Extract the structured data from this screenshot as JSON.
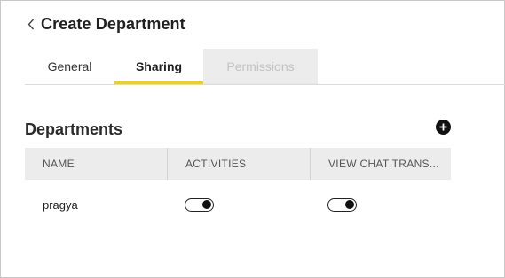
{
  "header": {
    "title": "Create Department"
  },
  "tabs": [
    {
      "label": "General"
    },
    {
      "label": "Sharing"
    },
    {
      "label": "Permissions"
    }
  ],
  "section": {
    "title": "Departments"
  },
  "table": {
    "columns": [
      "NAME",
      "ACTIVITIES",
      "VIEW CHAT TRANS..."
    ],
    "rows": [
      {
        "name": "pragya",
        "activities": true,
        "view_chat_transcripts": true
      }
    ]
  },
  "colors": {
    "accent": "#f2d500",
    "header_bg": "#ececec"
  },
  "icons": {
    "back": "chevron-left-icon",
    "add": "plus-circle-icon"
  }
}
